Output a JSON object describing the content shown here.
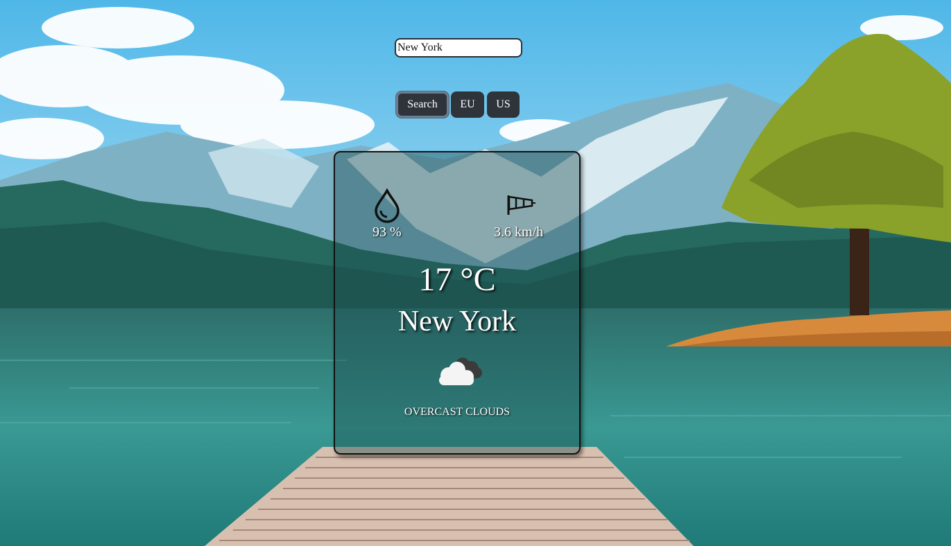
{
  "search": {
    "value": "New York"
  },
  "buttons": {
    "search_label": "Search",
    "eu_label": "EU",
    "us_label": "US"
  },
  "weather": {
    "humidity": "93 %",
    "wind": "3.6 km/h",
    "temperature": "17 °C",
    "city": "New York",
    "description": "OVERCAST CLOUDS",
    "condition_icon": "overcast-clouds-icon"
  },
  "icons": {
    "humidity": "water-drop-icon",
    "wind": "windsock-icon"
  },
  "colors": {
    "button_bg": "#2f343b",
    "card_border": "#111111",
    "text": "#ffffff"
  }
}
